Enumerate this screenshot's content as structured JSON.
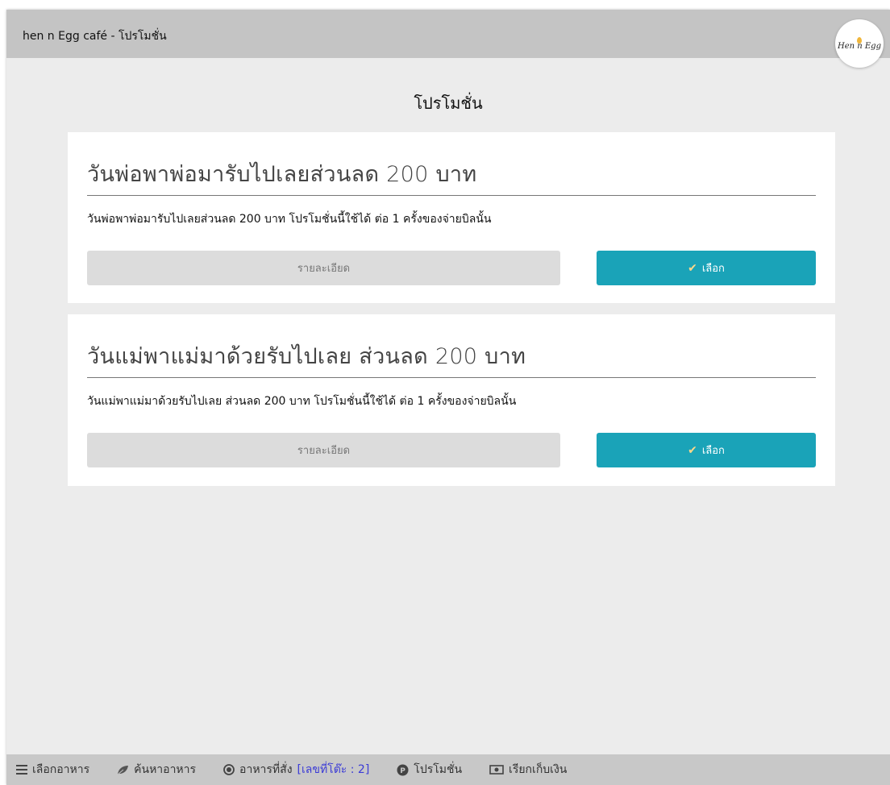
{
  "window": {
    "title": "hen n Egg café - โปรโมชั่น",
    "logo_text": "Hen n Egg"
  },
  "page": {
    "title": "โปรโมชั่น"
  },
  "promotions": [
    {
      "title": "วันพ่อพาพ่อมารับไปเลยส่วนลด 200 บาท",
      "description": "วันพ่อพาพ่อมารับไปเลยส่วนลด 200 บาท โปรโมชั่นนี้ใช้ได้ ต่อ 1 ครั้งของจ่ายบิลนั้น",
      "detail_label": "รายละเอียด",
      "select_label": "เลือก"
    },
    {
      "title": "วันแม่พาแม่มาด้วยรับไปเลย ส่วนลด 200 บาท",
      "description": "วันแม่พาแม่มาด้วยรับไปเลย ส่วนลด 200 บาท โปรโมชั่นนี้ใช้ได้ ต่อ 1 ครั้งของจ่ายบิลนั้น",
      "detail_label": "รายละเอียด",
      "select_label": "เลือก"
    }
  ],
  "bottom_nav": {
    "menu": {
      "label": "เลือกอาหาร",
      "icon": "menu-icon"
    },
    "search": {
      "label": "ค้นหาอาหาร",
      "icon": "leaf-icon"
    },
    "orders": {
      "label": "อาหารที่สั่ง",
      "table_label": "[เลขที่โต๊ะ : 2]",
      "icon": "order-icon"
    },
    "promotion": {
      "label": "โปรโมชั่น",
      "icon": "promotion-icon"
    },
    "checkout": {
      "label": "เรียกเก็บเงิน",
      "icon": "money-icon"
    }
  },
  "colors": {
    "select_button": "#1aa3b8",
    "detail_button": "#dcdcdc",
    "titlebar": "#c4c4c4",
    "background": "#ececec",
    "table_number": "#3b3bd6"
  }
}
